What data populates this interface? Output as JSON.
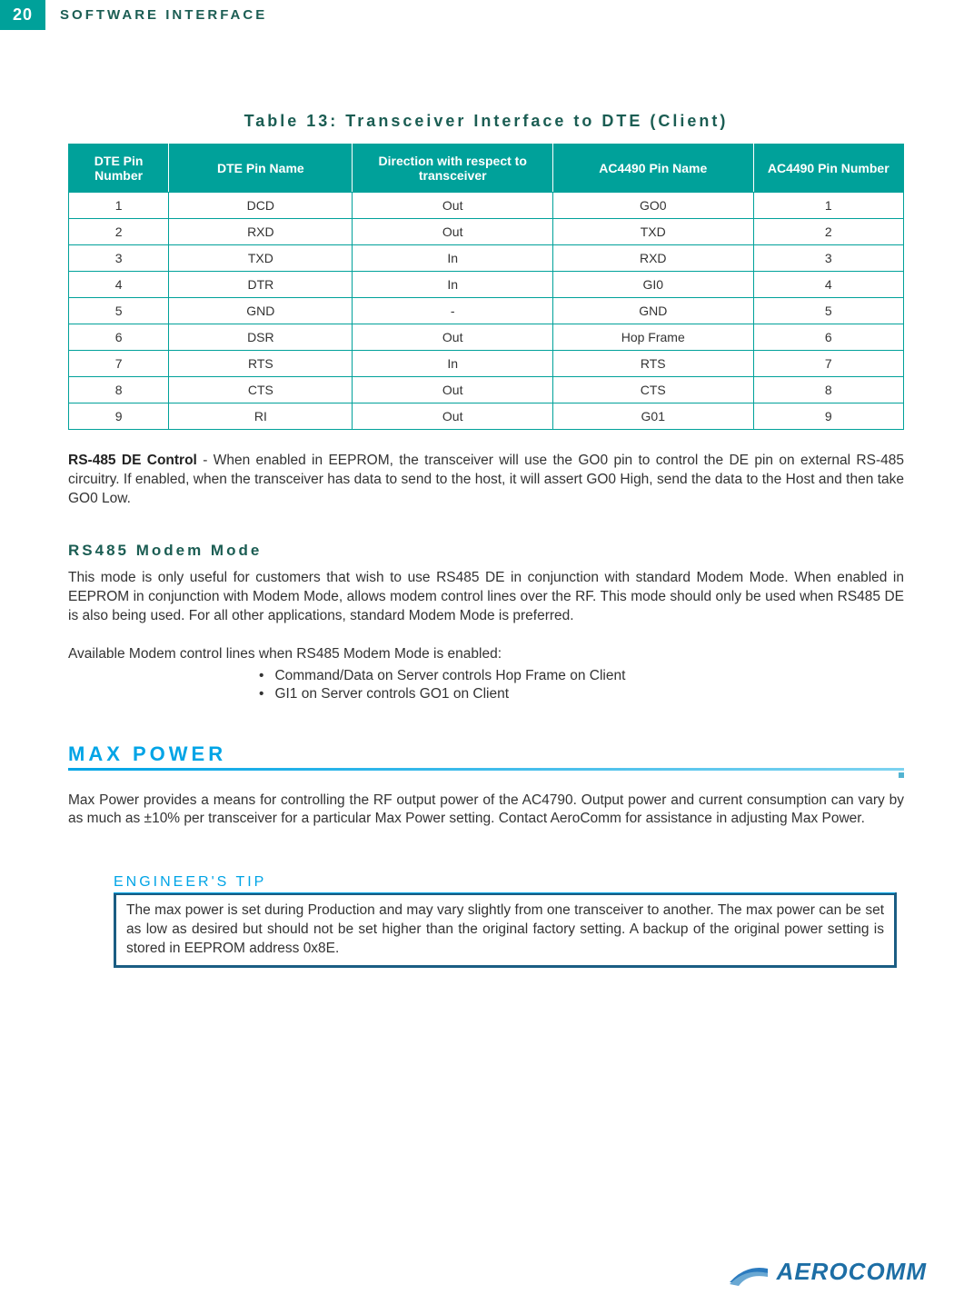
{
  "page_number": "20",
  "section_header": "SOFTWARE INTERFACE",
  "table": {
    "title": "Table 13: Transceiver Interface to DTE (Client)",
    "headers": {
      "c0": "DTE Pin Number",
      "c1": "DTE Pin Name",
      "c2": "Direction with respect to transceiver",
      "c3": "AC4490 Pin Name",
      "c4": "AC4490 Pin Number"
    },
    "rows": [
      {
        "c0": "1",
        "c1": "DCD",
        "c2": "Out",
        "c3": "GO0",
        "c4": "1"
      },
      {
        "c0": "2",
        "c1": "RXD",
        "c2": "Out",
        "c3": "TXD",
        "c4": "2"
      },
      {
        "c0": "3",
        "c1": "TXD",
        "c2": "In",
        "c3": "RXD",
        "c4": "3"
      },
      {
        "c0": "4",
        "c1": "DTR",
        "c2": "In",
        "c3": "GI0",
        "c4": "4"
      },
      {
        "c0": "5",
        "c1": "GND",
        "c2": "-",
        "c3": "GND",
        "c4": "5"
      },
      {
        "c0": "6",
        "c1": "DSR",
        "c2": "Out",
        "c3": "Hop Frame",
        "c4": "6"
      },
      {
        "c0": "7",
        "c1": "RTS",
        "c2": "In",
        "c3": "RTS",
        "c4": "7"
      },
      {
        "c0": "8",
        "c1": "CTS",
        "c2": "Out",
        "c3": "CTS",
        "c4": "8"
      },
      {
        "c0": "9",
        "c1": "RI",
        "c2": "Out",
        "c3": "G01",
        "c4": "9"
      }
    ]
  },
  "rs485_de": {
    "term": "RS-485 DE Control",
    "text": " - When enabled in EEPROM, the transceiver will use the GO0 pin to control the DE pin on external RS-485 circuitry.  If enabled, when the transceiver has data to send to the host, it will assert GO0 High, send the data to the Host and then take GO0 Low."
  },
  "rs485_modem": {
    "heading": "RS485 Modem Mode",
    "para": "This mode is only useful for customers that wish to use RS485 DE in conjunction with standard Modem Mode.  When enabled in EEPROM in conjunction with Modem Mode, allows modem control lines over the RF.  This mode should only be used when RS485 DE is also being used.  For all other applications, standard Modem Mode is preferred.",
    "list_intro": "Available Modem control lines when RS485 Modem Mode is enabled:",
    "bullets": [
      "Command/Data on Server controls Hop Frame on Client",
      "GI1 on Server controls GO1 on Client"
    ]
  },
  "max_power": {
    "heading": "MAX POWER",
    "para": "Max Power provides a means for controlling the RF output power of the AC4790.  Output power and current consumption can vary by as much as ±10% per transceiver for a particular Max Power setting.  Contact AeroComm for assistance in adjusting Max Power."
  },
  "tip": {
    "heading": "ENGINEER'S TIP",
    "text": "The max power is set during Production and may vary slightly from one transceiver to another. The max power can be set as low as desired but should not be set higher than the original factory setting.  A backup of the original power setting is stored in EEPROM address 0x8E."
  },
  "logo": {
    "brand": "AEROCOMM"
  }
}
